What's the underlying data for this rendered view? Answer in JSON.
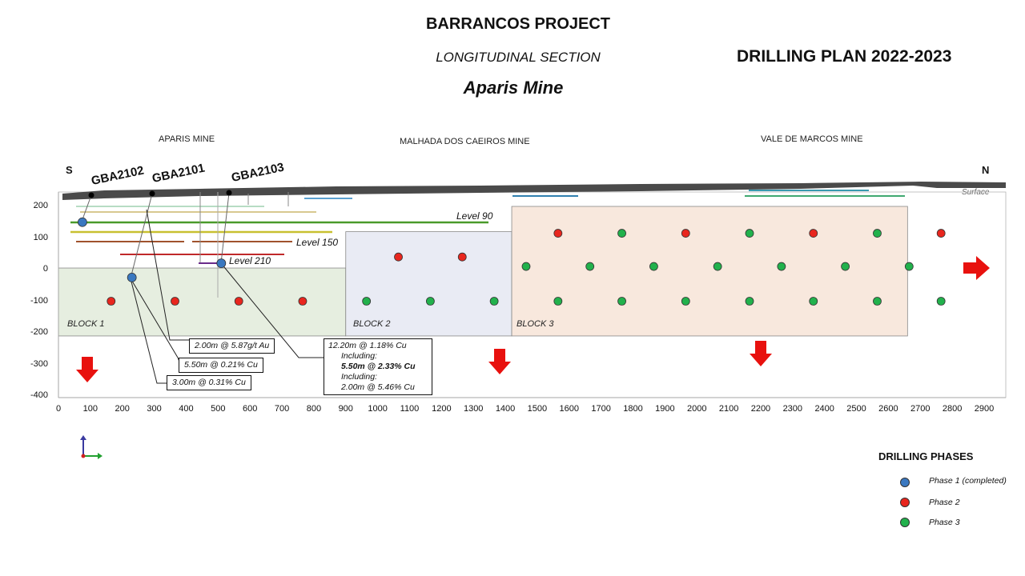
{
  "header": {
    "project": "BARRANCOS PROJECT",
    "section": "LONGITUDINAL SECTION",
    "mine": "Aparis Mine",
    "plan": "DRILLING PLAN 2022-2023"
  },
  "section_labels": {
    "mines": [
      "APARIS MINE",
      "MALHADA DOS CAEIROS MINE",
      "VALE DE MARCOS MINE"
    ],
    "south": "S",
    "north": "N",
    "surface": "Surface"
  },
  "drillholes": [
    "GBA2102",
    "GBA2101",
    "GBA2103"
  ],
  "levels": [
    "Level 90",
    "Level 150",
    "Level 210"
  ],
  "blocks": [
    "BLOCK 1",
    "BLOCK 2",
    "BLOCK 3"
  ],
  "intercepts": {
    "gba2102_au": "2.00m @ 5.87g/t Au",
    "gba2101_a": "5.50m @ 0.21% Cu",
    "gba2101_b": "3.00m @ 0.31% Cu",
    "gba2103_l1": "12.20m @ 1.18% Cu",
    "gba2103_l2": "Including:",
    "gba2103_l3": "5.50m @ 2.33% Cu",
    "gba2103_l4": "Including:",
    "gba2103_l5": "2.00m @ 5.46% Cu"
  },
  "legend": {
    "title": "DRILLING PHASES",
    "items": [
      {
        "label": "Phase 1 (completed)",
        "color": "#3a78c0"
      },
      {
        "label": "Phase 2",
        "color": "#e8261e"
      },
      {
        "label": "Phase 3",
        "color": "#22b14c"
      }
    ]
  },
  "chart_data": {
    "type": "scatter",
    "x_ticks": [
      "0",
      "100",
      "200",
      "300",
      "400",
      "500",
      "600",
      "700",
      "800",
      "900",
      "1000",
      "1100",
      "1200",
      "1300",
      "1400",
      "1500",
      "1600",
      "1700",
      "1800",
      "1900",
      "2000",
      "2100",
      "2200",
      "2300",
      "2400",
      "2500",
      "2600",
      "2700",
      "2800",
      "2900"
    ],
    "y_ticks": [
      "200",
      "100",
      "0",
      "-100",
      "-200",
      "-300",
      "-400"
    ],
    "xlim": [
      0,
      2950
    ],
    "ylim": [
      -400,
      240
    ],
    "series": [
      {
        "name": "Phase 1 (completed)",
        "points": [
          [
            75,
            150
          ],
          [
            230,
            -25
          ],
          [
            510,
            20
          ]
        ]
      },
      {
        "name": "Phase 2",
        "points": [
          [
            165,
            -100
          ],
          [
            365,
            -100
          ],
          [
            565,
            -100
          ],
          [
            765,
            -100
          ],
          [
            1065,
            40
          ],
          [
            1265,
            40
          ],
          [
            1565,
            115
          ],
          [
            1965,
            115
          ],
          [
            2365,
            115
          ],
          [
            2765,
            115
          ]
        ]
      },
      {
        "name": "Phase 3",
        "points": [
          [
            965,
            -100
          ],
          [
            1165,
            -100
          ],
          [
            1365,
            -100
          ],
          [
            1465,
            10
          ],
          [
            1665,
            10
          ],
          [
            1865,
            10
          ],
          [
            2065,
            10
          ],
          [
            2265,
            10
          ],
          [
            2465,
            10
          ],
          [
            2665,
            10
          ],
          [
            1565,
            -100
          ],
          [
            1765,
            -100
          ],
          [
            1965,
            -100
          ],
          [
            2165,
            -100
          ],
          [
            2365,
            -100
          ],
          [
            2565,
            -100
          ],
          [
            2765,
            -100
          ],
          [
            1765,
            115
          ],
          [
            2165,
            115
          ],
          [
            2565,
            115
          ]
        ]
      }
    ],
    "blocks": [
      {
        "name": "BLOCK 1",
        "x": [
          0,
          900
        ],
        "y": [
          -210,
          5
        ],
        "color": "#e6eee0"
      },
      {
        "name": "BLOCK 2",
        "x": [
          900,
          1420
        ],
        "y": [
          -210,
          120
        ],
        "color": "#e9ebf4"
      },
      {
        "name": "BLOCK 3",
        "x": [
          1420,
          2660
        ],
        "y": [
          -210,
          200
        ],
        "color": "#f8e8dd"
      }
    ]
  }
}
